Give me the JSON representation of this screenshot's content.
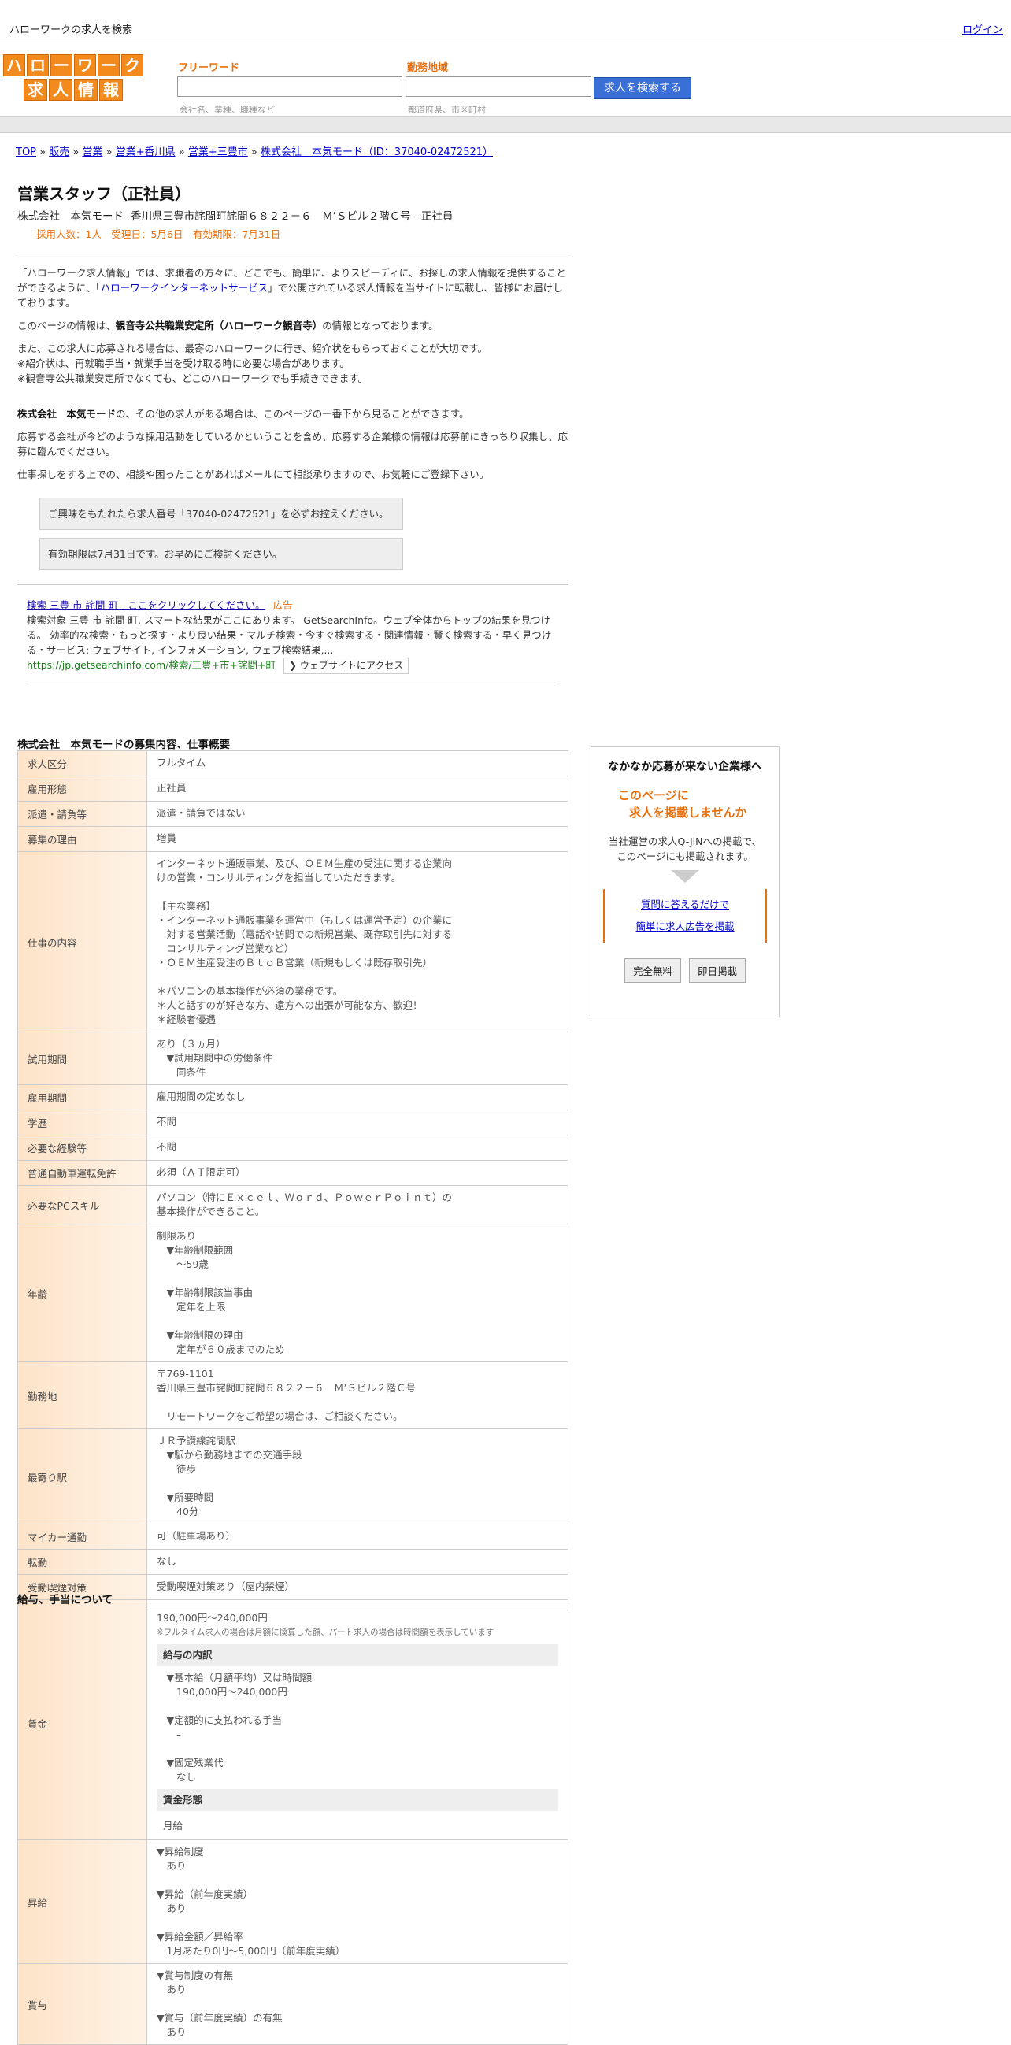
{
  "topbar": {
    "title": "ハローワークの求人を検索",
    "login": "ログイン"
  },
  "logo": {
    "row1": [
      "ハ",
      "ロ",
      "ー",
      "ワ",
      "ー",
      "ク"
    ],
    "row2": [
      "求",
      "人",
      "情",
      "報"
    ]
  },
  "search": {
    "keyword_label": "フリーワード",
    "keyword_hint": "会社名、業種、職種など",
    "area_label": "勤務地域",
    "area_hint": "都道府県、市区町村",
    "button": "求人を検索する"
  },
  "breadcrumb": {
    "items": [
      "TOP",
      "販売",
      "営業",
      "営業+香川県",
      "営業+三豊市",
      "株式会社　本気モード（ID：37040-02472521）"
    ],
    "sep": " » "
  },
  "job": {
    "title": "営業スタッフ（正社員）",
    "subtitle": "株式会社　本気モード -香川県三豊市詫間町詫間６８２２－６　Ｍ’Ｓビル２階Ｃ号 - 正社員",
    "meta": "採用人数：1人　受理日：5月6日　有効期限：7月31日"
  },
  "intro": {
    "p1_a": "「ハローワーク求人情報」では、求職者の方々に、どこでも、簡単に、よりスピーディに、お探しの求人情報を提供することができるように、「",
    "p1_link": "ハローワークインターネットサービス",
    "p1_b": "」で公開されている求人情報を当サイトに転載し、皆様にお届けしております。",
    "p2_a": "このページの情報は、",
    "p2_b": "観音寺公共職業安定所（ハローワーク観音寺）",
    "p2_c": "の情報となっております。",
    "p3_l1": "また、この求人に応募される場合は、最寄のハローワークに行き、紹介状をもらっておくことが大切です。",
    "p3_l2": "※紹介状は、再就職手当・就業手当を受け取る時に必要な場合があります。",
    "p3_l3": "※観音寺公共職業安定所でなくても、どこのハローワークでも手続きできます。",
    "p4_a": "株式会社　本気モード",
    "p4_b": "の、その他の求人がある場合は、このページの一番下から見ることができます。",
    "p5": "応募する会社が今どのような採用活動をしているかということを含め、応募する企業様の情報は応募前にきっちり収集し、応募に臨んでください。",
    "p6": "仕事探しをする上での、相談や困ったことがあればメールにて相談承りますので、お気軽にご登録下さい。"
  },
  "notes": {
    "n1": "ご興味をもたれたら求人番号「37040-02472521」を必ずお控えください。",
    "n2": "有効期限は7月31日です。お早めにご検討ください。"
  },
  "ad": {
    "title": "検索 三豊 市 詫間 町 - ここをクリックしてください。",
    "tag": "広告",
    "body": "検索対象 三豊 市 詫間 町, スマートな結果がここにあります。 GetSearchInfo。ウェブ全体からトップの結果を見つける。 効率的な検索・もっと探す・より良い結果・マルチ検索・今すぐ検索する・関連情報・賢く検索する・早く見つける・サービス: ウェブサイト, インフォメーション, ウェブ検索結果,...",
    "url": "https://jp.getsearchinfo.com/検索/三豊+市+詫間+町",
    "button": "❯ ウェブサイトにアクセス"
  },
  "section1": {
    "title": "株式会社　本気モードの募集内容、仕事概要",
    "rows": [
      {
        "h": "求人区分",
        "v": "フルタイム"
      },
      {
        "h": "雇用形態",
        "v": "正社員"
      },
      {
        "h": "派遣・請負等",
        "v": "派遣・請負ではない"
      },
      {
        "h": "募集の理由",
        "v": "増員"
      },
      {
        "h": "仕事の内容",
        "v": "インターネット通販事業、及び、ＯＥＭ生産の受注に関する企業向\nけの営業・コンサルティングを担当していただきます。\n\n【主な業務】\n・インターネット通販事業を運営中（もしくは運営予定）の企業に\n　対する営業活動（電話や訪問での新規営業、既存取引先に対する\n　コンサルティング営業など）\n・ＯＥＭ生産受注のＢｔｏＢ営業（新規もしくは既存取引先）\n\n＊パソコンの基本操作が必須の業務です。\n＊人と話すのが好きな方、遠方への出張が可能な方、歓迎！\n＊経験者優遇"
      },
      {
        "h": "試用期間",
        "v": "あり（３ヵ月）\n　▼試用期間中の労働条件\n　　同条件"
      },
      {
        "h": "雇用期間",
        "v": "雇用期間の定めなし"
      },
      {
        "h": "学歴",
        "v": "不問"
      },
      {
        "h": "必要な経験等",
        "v": "不問"
      },
      {
        "h": "普通自動車運転免許",
        "v": "必須（ＡＴ限定可）"
      },
      {
        "h": "必要なPCスキル",
        "v": "パソコン（特にＥｘｃｅｌ、Ｗｏｒｄ、ＰｏｗｅｒＰｏｉｎｔ）の\n基本操作ができること。"
      },
      {
        "h": "年齢",
        "v": "制限あり\n　▼年齢制限範囲\n　　〜59歳\n\n　▼年齢制限該当事由\n　　定年を上限\n\n　▼年齢制限の理由\n　　定年が６０歳までのため"
      },
      {
        "h": "勤務地",
        "v": "〒769-1101\n香川県三豊市詫間町詫間６８２２－６　Ｍ’Ｓビル２階Ｃ号\n\n　リモートワークをご希望の場合は、ご相談ください。"
      },
      {
        "h": "最寄り駅",
        "v": "ＪＲ予讃線詫間駅\n　▼駅から勤務地までの交通手段\n　　徒歩\n\n　▼所要時間\n　　40分"
      },
      {
        "h": "マイカー通勤",
        "v": "可（駐車場あり）"
      },
      {
        "h": "転勤",
        "v": "なし"
      },
      {
        "h": "受動喫煙対策",
        "v": "受動喫煙対策あり（屋内禁煙）"
      }
    ]
  },
  "sidebox": {
    "title": "なかなか応募が来ない企業様へ",
    "catch1": "このページに",
    "catch2": "求人を掲載しませんか",
    "desc1": "当社運営の求人Q-JiNへの掲載で、",
    "desc2": "このページにも掲載されます。",
    "link1": "質問に答えるだけで",
    "link2": "簡単に求人広告を掲載",
    "btn1": "完全無料",
    "btn2": "即日掲載"
  },
  "section2": {
    "title": "給与、手当について",
    "wage_h": "賃金",
    "wage_range": "190,000円〜240,000円",
    "wage_note": "※フルタイム求人の場合は月額に換算した額、パート求人の場合は時間額を表示しています",
    "breakdown_title": "給与の内訳",
    "breakdown": "　▼基本給（月額平均）又は時間額\n　　190,000円〜240,000円\n\n　▼定額的に支払われる手当\n　　-\n\n　▼固定残業代\n　　なし",
    "form_title": "賃金形態",
    "form_value": "月給",
    "raise_h": "昇給",
    "raise": "▼昇給制度\n　あり\n\n▼昇給（前年度実績）\n　あり\n\n▼昇給金額／昇給率\n　1月あたり0円〜5,000円（前年度実績）",
    "bonus_h": "賞与",
    "bonus": "▼賞与制度の有無\n　あり\n\n▼賞与（前年度実績）の有無\n　あり"
  }
}
